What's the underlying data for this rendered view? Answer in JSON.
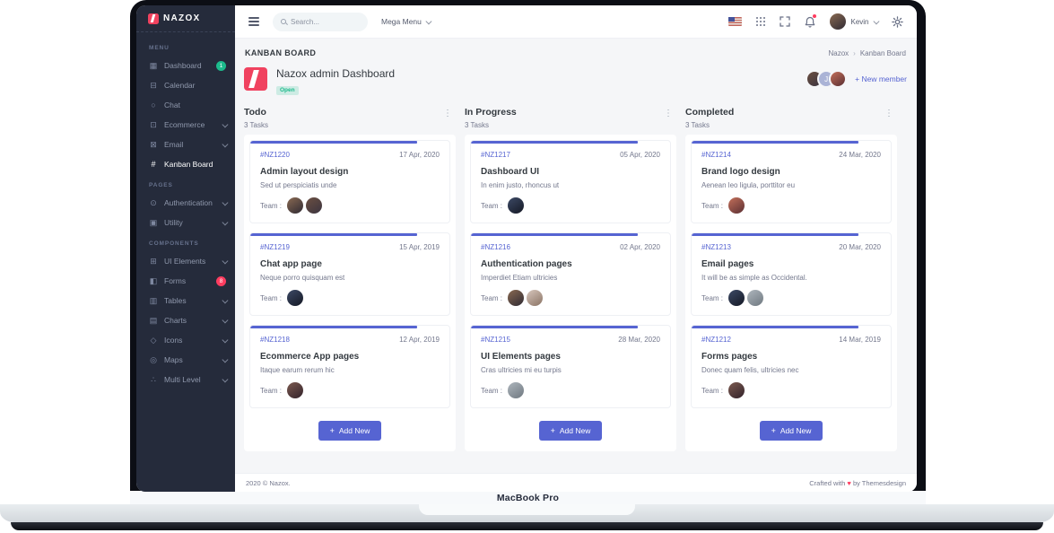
{
  "laptop": {
    "label": "MacBook Pro"
  },
  "colors": {
    "primary": "#5664d2",
    "red": "#ff3d60",
    "green": "#1cbb8c",
    "sidebar_bg": "#252b3b"
  },
  "icons": {
    "dashboard": "▦",
    "calendar": "⊟",
    "chat": "○",
    "ecommerce": "⊡",
    "email": "⊠",
    "kanban": "#",
    "authentication": "⊙",
    "utility": "▣",
    "ui_elements": "⊞",
    "forms": "◧",
    "tables": "▥",
    "charts": "▤",
    "icons": "◇",
    "maps": "◎",
    "multi_level": "∴",
    "dots_vertical": "⋮",
    "breadcrumb_sep": "›",
    "plus": "+",
    "heart": "♥"
  },
  "sidebar": {
    "brand": "NAZOX",
    "sections": [
      {
        "label": "MENU",
        "items": [
          {
            "label": "Dashboard",
            "badge": "1"
          },
          {
            "label": "Calendar"
          },
          {
            "label": "Chat"
          },
          {
            "label": "Ecommerce"
          },
          {
            "label": "Email"
          },
          {
            "label": "Kanban Board"
          }
        ]
      },
      {
        "label": "PAGES",
        "items": [
          {
            "label": "Authentication"
          },
          {
            "label": "Utility"
          }
        ]
      },
      {
        "label": "COMPONENTS",
        "items": [
          {
            "label": "UI Elements"
          },
          {
            "label": "Forms",
            "badge": "8"
          },
          {
            "label": "Tables"
          },
          {
            "label": "Charts"
          },
          {
            "label": "Icons"
          },
          {
            "label": "Maps"
          },
          {
            "label": "Multi Level"
          }
        ]
      }
    ]
  },
  "topbar": {
    "search_placeholder": "Search...",
    "mega_menu": "Mega Menu",
    "user": "Kevin"
  },
  "page": {
    "title": "KANBAN BOARD",
    "breadcrumb": {
      "parent": "Nazox",
      "current": "Kanban Board"
    },
    "board": {
      "title": "Nazox admin Dashboard",
      "status": "Open",
      "new_member": "New member",
      "member_initial": "J",
      "team_label": "Team :"
    }
  },
  "columns": [
    {
      "title": "Todo",
      "count": "3 Tasks",
      "add_label": "Add New",
      "cards": [
        {
          "id": "#NZ1220",
          "date": "17 Apr, 2020",
          "title": "Admin layout design",
          "desc": "Sed ut perspiciatis unde"
        },
        {
          "id": "#NZ1219",
          "date": "15 Apr, 2019",
          "title": "Chat app page",
          "desc": "Neque porro quisquam est"
        },
        {
          "id": "#NZ1218",
          "date": "12 Apr, 2019",
          "title": "Ecommerce App pages",
          "desc": "Itaque earum rerum hic"
        }
      ]
    },
    {
      "title": "In Progress",
      "count": "3 Tasks",
      "add_label": "Add New",
      "cards": [
        {
          "id": "#NZ1217",
          "date": "05 Apr, 2020",
          "title": "Dashboard UI",
          "desc": "In enim justo, rhoncus ut"
        },
        {
          "id": "#NZ1216",
          "date": "02 Apr, 2020",
          "title": "Authentication pages",
          "desc": "Imperdiet Etiam ultricies"
        },
        {
          "id": "#NZ1215",
          "date": "28 Mar, 2020",
          "title": "UI Elements pages",
          "desc": "Cras ultricies mi eu turpis"
        }
      ]
    },
    {
      "title": "Completed",
      "count": "3 Tasks",
      "add_label": "Add New",
      "cards": [
        {
          "id": "#NZ1214",
          "date": "24 Mar, 2020",
          "title": "Brand logo design",
          "desc": "Aenean leo ligula, porttitor eu"
        },
        {
          "id": "#NZ1213",
          "date": "20 Mar, 2020",
          "title": "Email pages",
          "desc": "It will be as simple as Occidental."
        },
        {
          "id": "#NZ1212",
          "date": "14 Mar, 2019",
          "title": "Forms pages",
          "desc": "Donec quam felis, ultricies nec"
        }
      ]
    }
  ],
  "footer": {
    "copyright": "2020 © Nazox.",
    "crafted_prefix": "Crafted with",
    "heart": "♥",
    "crafted_suffix": "by Themesdesign"
  }
}
